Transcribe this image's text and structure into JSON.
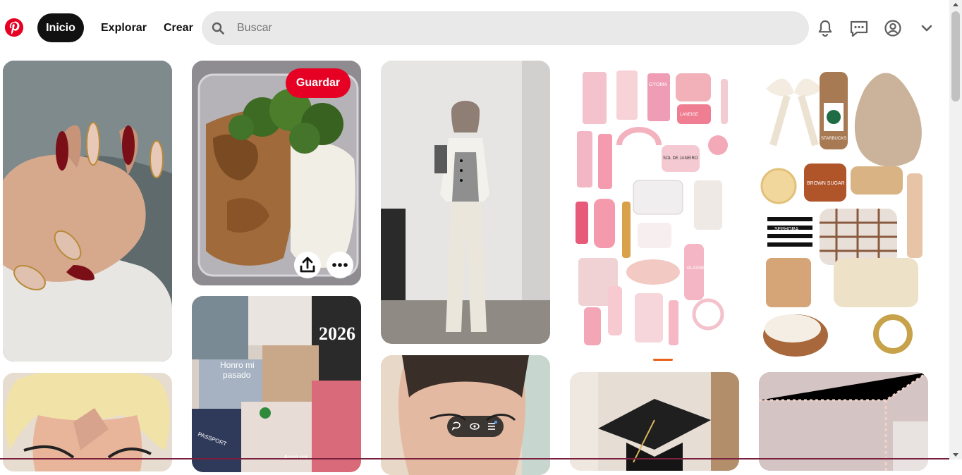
{
  "header": {
    "nav": {
      "home": "Inicio",
      "explore": "Explorar",
      "create": "Crear"
    },
    "search": {
      "placeholder": "Buscar",
      "value": ""
    },
    "icons": [
      "pinterest-logo",
      "search-icon",
      "bell-icon",
      "message-icon",
      "profile-icon",
      "chevron-down-icon"
    ]
  },
  "pins": [
    {
      "id": "nails",
      "subject": "manicure"
    },
    {
      "id": "meal-prep",
      "subject": "chicken-broccoli-rice"
    },
    {
      "id": "collage",
      "subject": "vision-board",
      "texts": [
        "Honro mi pasado",
        "2026",
        "PASSPORT",
        "Amo mi"
      ]
    },
    {
      "id": "outfit",
      "subject": "fashion"
    },
    {
      "id": "makeup",
      "subject": "face"
    },
    {
      "id": "pink-products",
      "subject": "beauty-products",
      "texts": [
        "GYOMA",
        "GLASSIER",
        "SOL DE JANEIRO",
        "LANEIGE"
      ]
    },
    {
      "id": "cozy-items",
      "subject": "wishlist",
      "texts": [
        "SEPHORA",
        "BROWN SUGAR",
        "STARBUCKS"
      ]
    },
    {
      "id": "blonde",
      "subject": "face"
    },
    {
      "id": "graduation",
      "subject": "cap"
    },
    {
      "id": "room-lights",
      "subject": "led-lights"
    }
  ],
  "hovered_pin": {
    "save_label": "Guardar",
    "actions": [
      "share-icon",
      "more-icon"
    ]
  },
  "video_controls": [
    "comment-icon",
    "view-icon",
    "list-icon"
  ],
  "colors": {
    "brand": "#e60023",
    "active_nav": "#111111",
    "search_bg": "#e9e9e9"
  }
}
